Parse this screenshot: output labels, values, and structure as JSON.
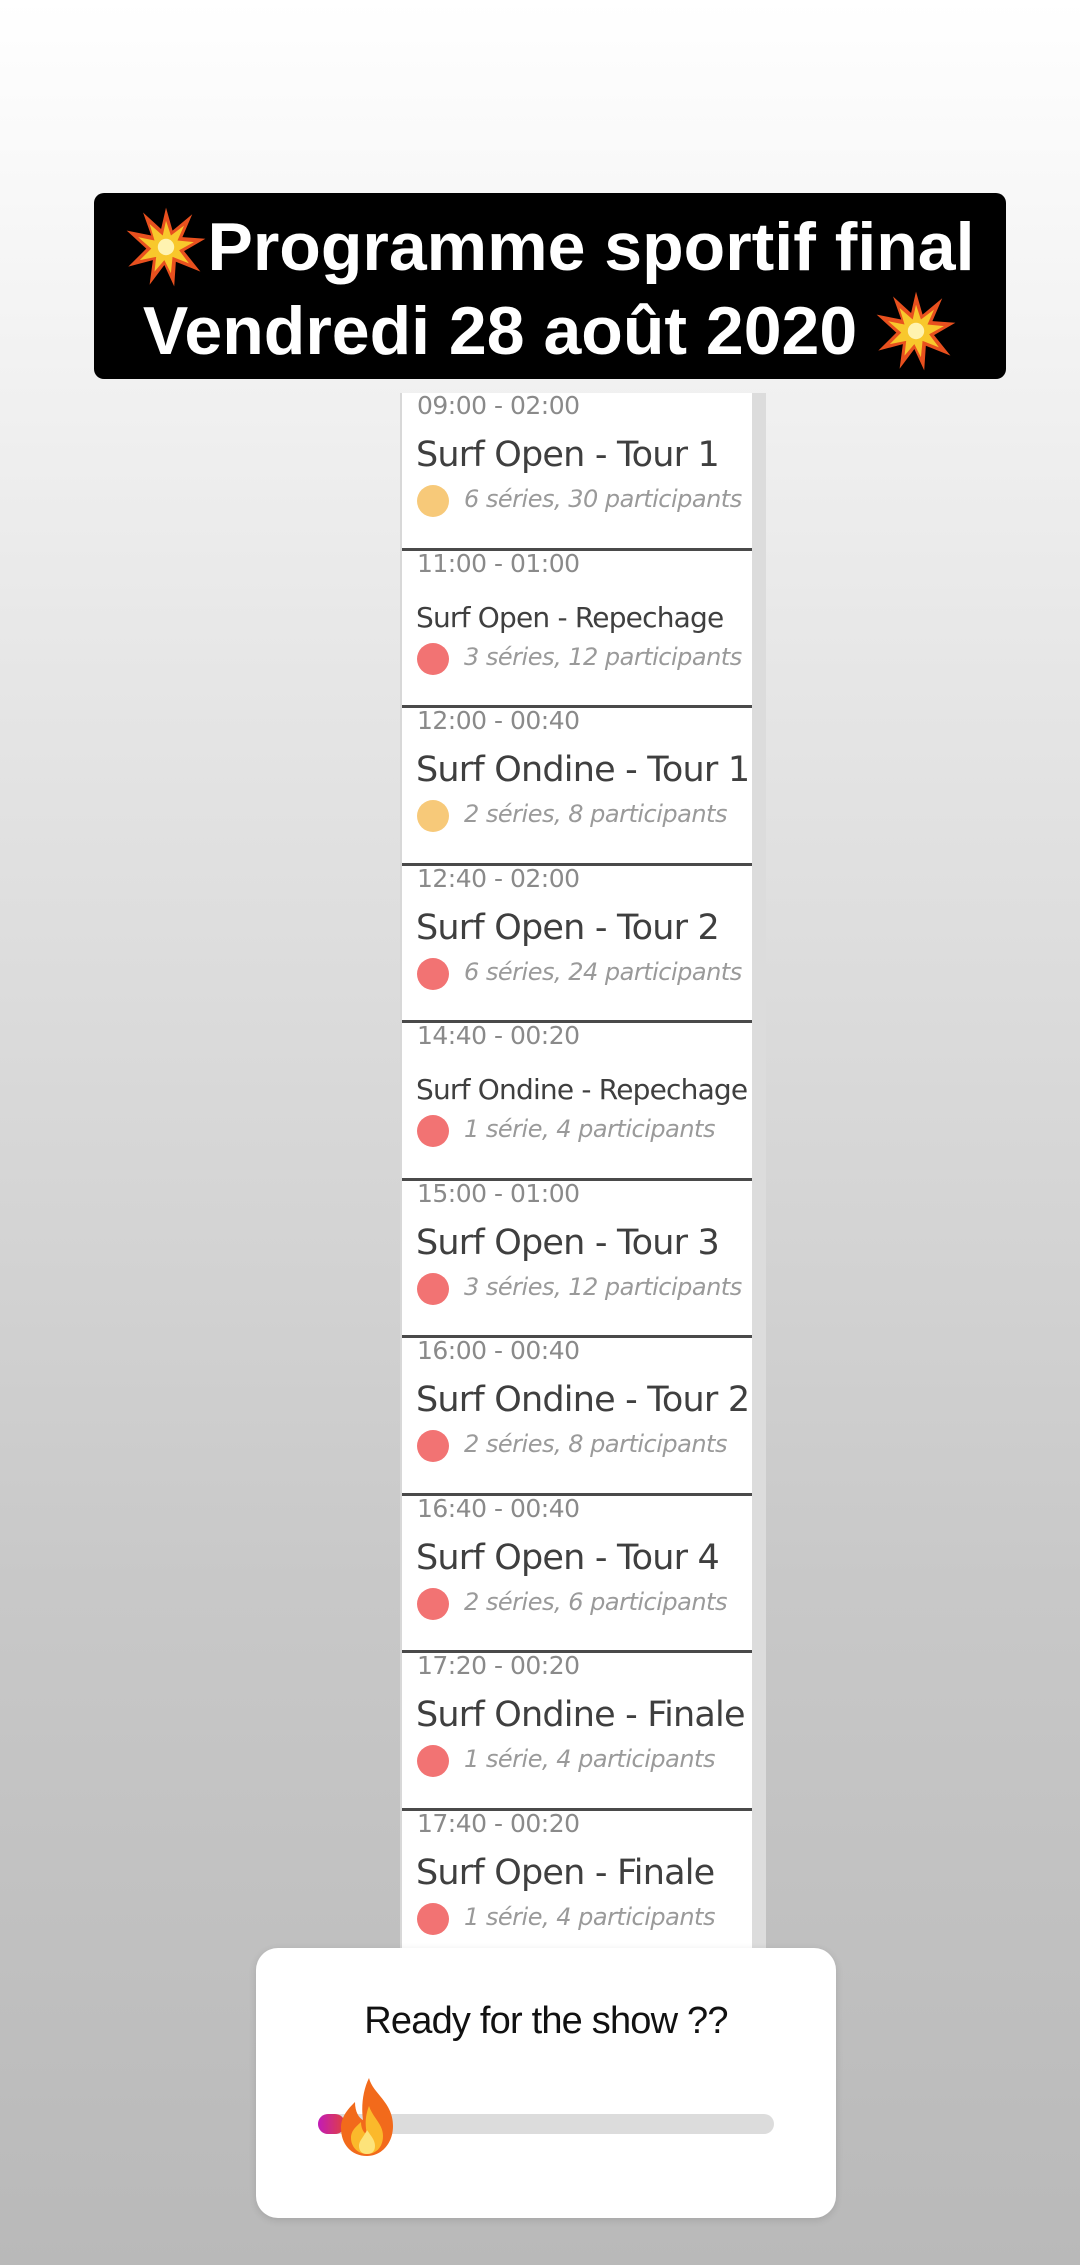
{
  "header": {
    "title_line1": "Programme sportif final",
    "title_line2": "Vendredi 28 août 2020",
    "decor_icon": "explosion-burst-emoji"
  },
  "colors": {
    "dot_yellow": "#f7c979",
    "dot_red": "#f27373",
    "slider_start": "#c21bb8",
    "slider_end": "#e04040"
  },
  "schedule": {
    "events": [
      {
        "time": "09:00 - 02:00",
        "name": "Surf Open - Tour 1",
        "details": "6 séries, 30 participants",
        "status": "yellow"
      },
      {
        "time": "11:00 - 01:00",
        "name": "Surf Open - Repechage",
        "details": "3 séries, 12 participants",
        "status": "red"
      },
      {
        "time": "12:00 - 00:40",
        "name": "Surf Ondine - Tour 1",
        "details": "2 séries, 8 participants",
        "status": "yellow"
      },
      {
        "time": "12:40 - 02:00",
        "name": "Surf Open - Tour 2",
        "details": "6 séries, 24 participants",
        "status": "red"
      },
      {
        "time": "14:40 - 00:20",
        "name": "Surf Ondine - Repechage",
        "details": "1 série, 4 participants",
        "status": "red"
      },
      {
        "time": "15:00 - 01:00",
        "name": "Surf Open - Tour 3",
        "details": "3 séries, 12 participants",
        "status": "red"
      },
      {
        "time": "16:00 - 00:40",
        "name": "Surf Ondine - Tour 2",
        "details": "2 séries, 8 participants",
        "status": "red"
      },
      {
        "time": "16:40 - 00:40",
        "name": "Surf Open - Tour 4",
        "details": "2 séries, 6 participants",
        "status": "red"
      },
      {
        "time": "17:20 - 00:20",
        "name": "Surf Ondine - Finale",
        "details": "1 série, 4 participants",
        "status": "red"
      },
      {
        "time": "17:40 - 00:20",
        "name": "Surf Open - Finale",
        "details": "1 série, 4 participants",
        "status": "red"
      }
    ]
  },
  "poll": {
    "question": "Ready for the show ??",
    "slider_icon": "fire-emoji",
    "slider_value": 0.06
  }
}
